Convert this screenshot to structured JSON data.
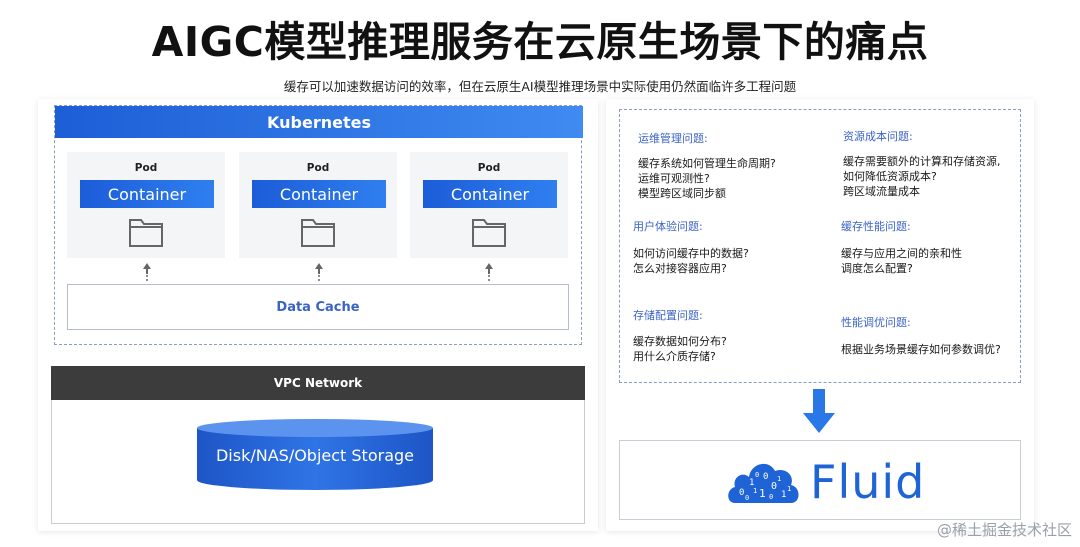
{
  "header": {
    "title": "AIGC模型推理服务在云原生场景下的痛点",
    "subtitle": "缓存可以加速数据访问的效率，但在云原生AI模型推理场景中实际使用仍然面临许多工程问题"
  },
  "left": {
    "kubernetes_label": "Kubernetes",
    "pods": [
      {
        "label": "Pod",
        "container": "Container"
      },
      {
        "label": "Pod",
        "container": "Container"
      },
      {
        "label": "Pod",
        "container": "Container"
      }
    ],
    "data_cache_label": "Data Cache",
    "vpc_label": "VPC Network",
    "storage_label": "Disk/NAS/Object Storage"
  },
  "right": {
    "issues": [
      {
        "title": "运维管理问题:",
        "lines": [
          "缓存系统如何管理生命周期?",
          "运维可观测性?",
          "模型跨区域同步额"
        ]
      },
      {
        "title": "资源成本问题:",
        "lines": [
          "缓存需要额外的计算和存储资源,",
          "如何降低资源成本?",
          "跨区域流量成本"
        ]
      },
      {
        "title": "用户体验问题:",
        "lines": [
          "如何访问缓存中的数据?",
          "怎么对接容器应用?"
        ]
      },
      {
        "title": "缓存性能问题:",
        "lines": [
          "缓存与应用之间的亲和性",
          "调度怎么配置?"
        ]
      },
      {
        "title": "存储配置问题:",
        "lines": [
          "缓存数据如何分布?",
          "用什么介质存储?"
        ]
      },
      {
        "title": "性能调优问题:",
        "lines": [
          "根据业务场景缓存如何参数调优?"
        ]
      }
    ],
    "fluid_name": "Fluid",
    "logo_digits": [
      "0",
      "1",
      "1",
      "0",
      "0",
      "1",
      "0",
      "1",
      "0",
      "1",
      "1",
      "0"
    ]
  },
  "watermark": "@稀土掘金技术社区",
  "colors": {
    "brand_blue": "#1f64d6",
    "issue_title_blue": "#3b63c6",
    "vpc_dark": "#3c3c3c",
    "cylinder_blue": "#2a66d8"
  }
}
